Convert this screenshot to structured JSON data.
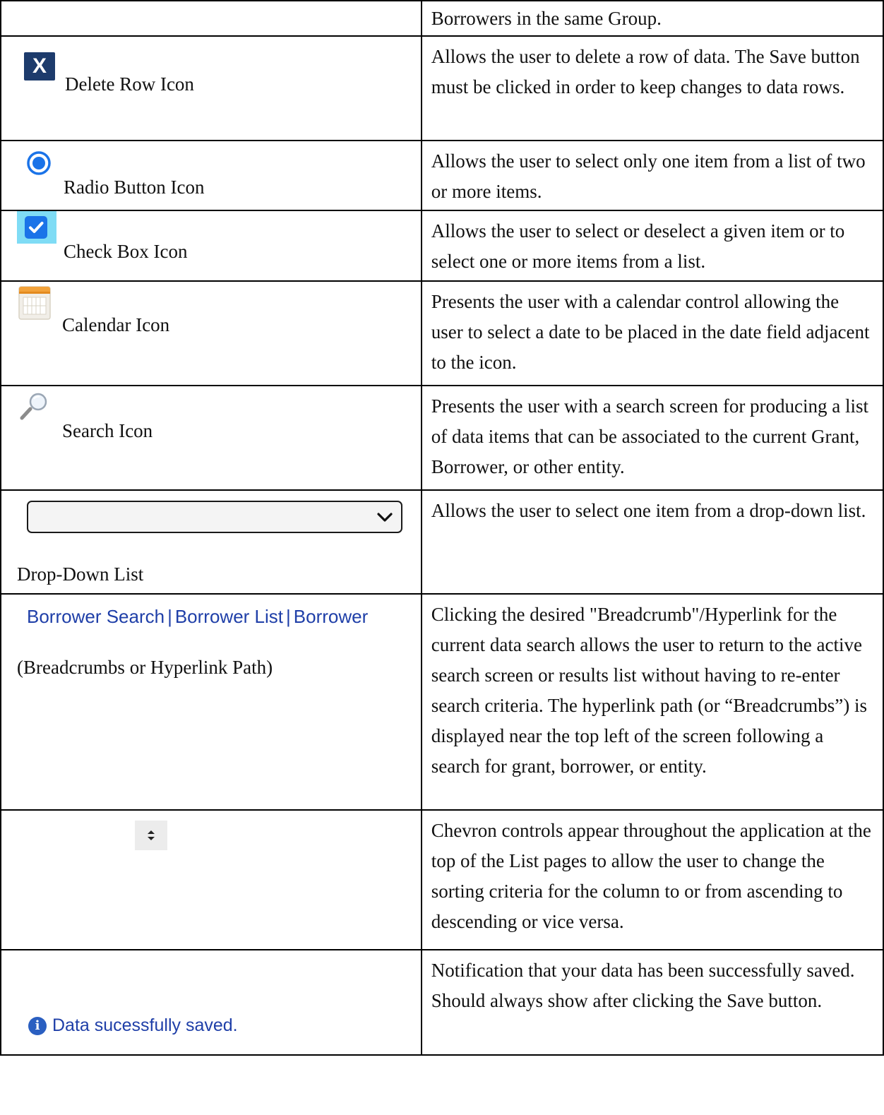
{
  "rows": [
    {
      "label": "",
      "description": "Borrowers in the same Group."
    },
    {
      "icon": "delete-row-icon",
      "icon_glyph": "X",
      "label": "Delete Row Icon",
      "description": "Allows the user to delete a row of data. The Save button must be clicked in order to keep changes to data rows."
    },
    {
      "icon": "radio-button-icon",
      "label": "Radio Button Icon",
      "description": "Allows the user to select only one item from a list of two or more items."
    },
    {
      "icon": "check-box-icon",
      "label": "Check Box Icon",
      "description": "Allows the user to select or deselect a given item or to select one or more items from a list."
    },
    {
      "icon": "calendar-icon",
      "label": "Calendar Icon",
      "description": "Presents the user with a calendar control allowing the user to select a date to be placed in the date field adjacent to the icon."
    },
    {
      "icon": "search-icon",
      "label": "Search Icon",
      "description": "Presents the user with a search screen for producing a list of data items that can be associated to the current Grant, Borrower, or other entity."
    },
    {
      "icon": "chevron-down-icon",
      "label": "Drop-Down List",
      "description": "Allows the user to select one item from a drop-down list."
    },
    {
      "breadcrumbs": [
        "Borrower Search",
        "Borrower List",
        "Borrower"
      ],
      "breadcrumb_separator": "|",
      "label": "(Breadcrumbs or Hyperlink Path)",
      "description": "Clicking the desired \"Breadcrumb\"/Hyperlink for the current data search allows the user to return to the active search screen or results list without having to re-enter search criteria. The hyperlink path (or “Breadcrumbs”) is displayed near the top left of the screen following a search for grant, borrower, or entity."
    },
    {
      "icon": "sort-chevron-icon",
      "label": "",
      "description": "Chevron controls appear throughout the application at the top of the List pages to allow the user to change the sorting criteria for the column to or from ascending to descending or vice versa."
    },
    {
      "icon": "info-icon",
      "icon_glyph": "i",
      "notification_text": "Data sucessfully saved.",
      "description": "Notification that your data has been successfully saved. Should always show after clicking the Save button."
    }
  ],
  "colors": {
    "border": "#000000",
    "delete_icon_bg": "#1d3b6c",
    "link": "#1f3fa8",
    "checkbox_blue": "#1a73e8",
    "checkbox_highlight": "#7fdcf5",
    "radio_blue": "#1a73e8"
  }
}
